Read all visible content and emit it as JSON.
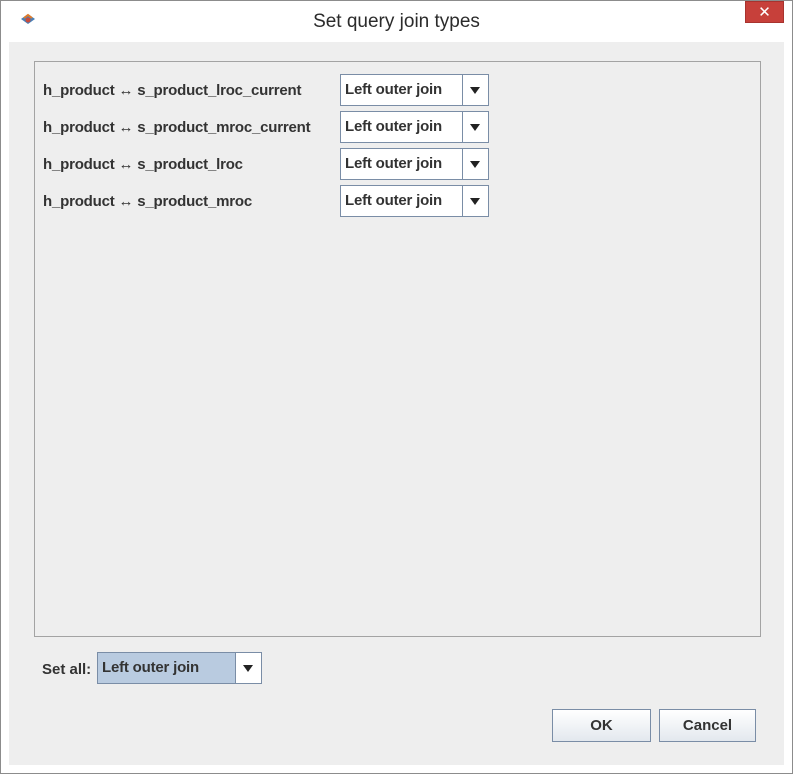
{
  "window": {
    "title": "Set query join types",
    "close_symbol": "✕",
    "app_icon": "java-app-icon"
  },
  "joins": [
    {
      "label": "h_product ↔ s_product_lroc_current",
      "value": "Left outer join"
    },
    {
      "label": "h_product ↔ s_product_mroc_current",
      "value": "Left outer join"
    },
    {
      "label": "h_product ↔ s_product_lroc",
      "value": "Left outer join"
    },
    {
      "label": "h_product ↔ s_product_mroc",
      "value": "Left outer join"
    }
  ],
  "set_all": {
    "label": "Set all:",
    "value": "Left outer join"
  },
  "buttons": {
    "ok": {
      "mnemonic": "O",
      "rest": "K"
    },
    "cancel": {
      "mnemonic": "C",
      "rest": "ancel"
    }
  },
  "colors": {
    "close_bg": "#c7403a",
    "dialog_bg": "#eeeeee",
    "combo_border": "#7a8da6",
    "set_all_selected_bg": "#b9cbe0"
  }
}
